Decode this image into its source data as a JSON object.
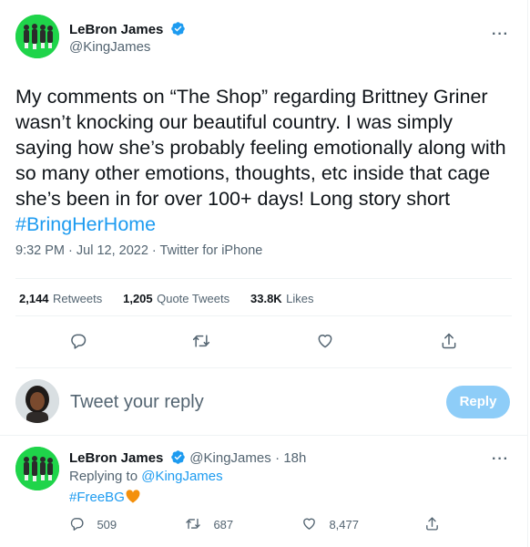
{
  "tweet": {
    "author_name": "LeBron James",
    "author_handle": "@KingJames",
    "text_main": "My comments on “The Shop” regarding Brittney Griner wasn’t knocking our beautiful country. I was simply saying how she’s probably feeling emotionally along with so many other emotions, thoughts, etc inside that cage she’s been in for over 100+ days! Long story short ",
    "hashtag": "#BringHerHome",
    "meta": "9:32 PM · Jul 12, 2022 · Twitter for iPhone",
    "stats": {
      "retweets_count": "2,144",
      "retweets_label": "Retweets",
      "quotes_count": "1,205",
      "quotes_label": "Quote Tweets",
      "likes_count": "33.8K",
      "likes_label": "Likes"
    }
  },
  "compose": {
    "placeholder": "Tweet your reply",
    "button_label": "Reply"
  },
  "reply": {
    "author_name": "LeBron James",
    "author_handle": "@KingJames",
    "time": "· 18h",
    "replying_prefix": "Replying to ",
    "replying_handle": "@KingJames",
    "text": "#FreeBG",
    "emoji": "🧡",
    "reply_count": "509",
    "retweet_count": "687",
    "like_count": "8,477"
  },
  "icons": {
    "more": "more-icon",
    "verified": "verified-badge-icon",
    "reply": "reply-icon",
    "retweet": "retweet-icon",
    "like": "heart-icon",
    "share": "share-icon"
  },
  "colors": {
    "accent": "#1d9bf0",
    "verified": "#1d9bf0",
    "muted_text": "#536471",
    "divider": "#eff3f4",
    "reply_button_disabled": "#8ecdf8",
    "avatar_bg": "#1fd44a"
  },
  "more_label": "···"
}
